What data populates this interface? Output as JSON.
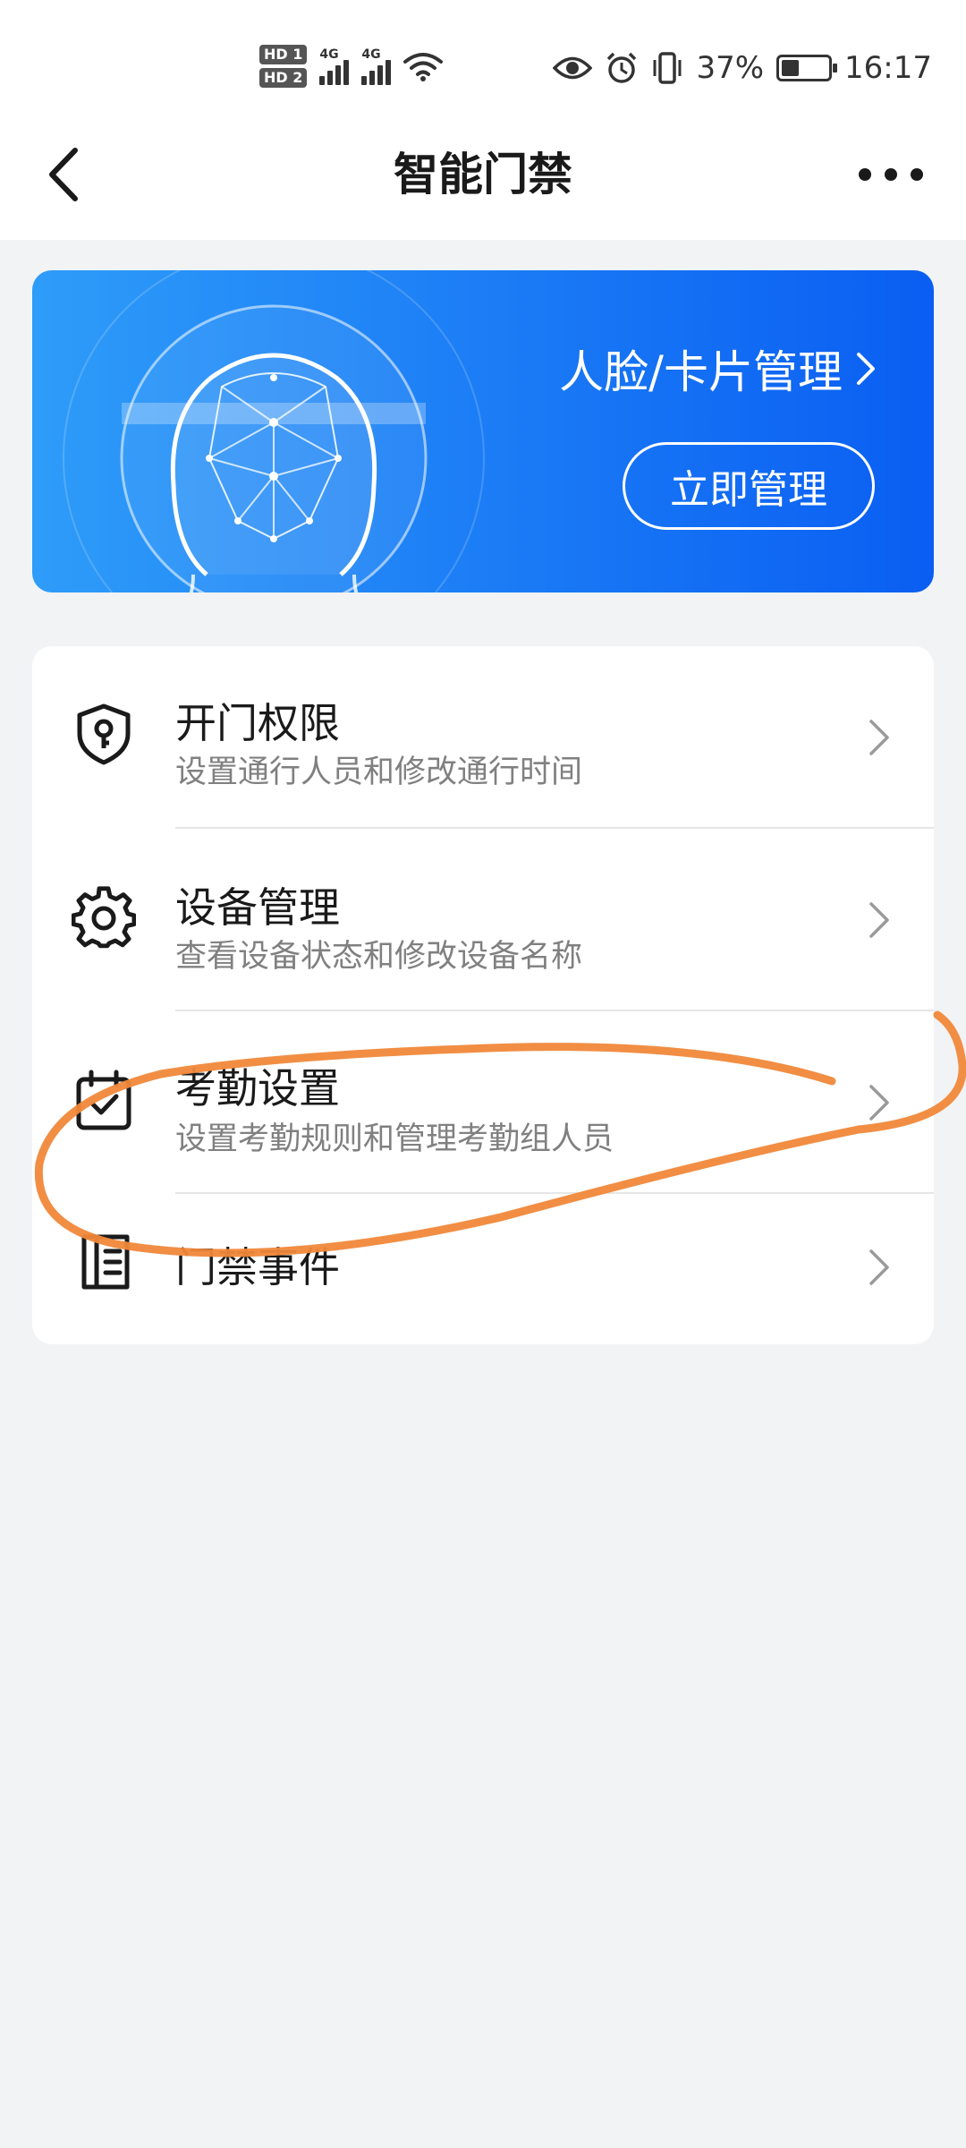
{
  "status_bar": {
    "sim1_label": "HD 1",
    "sim2_label": "HD 2",
    "net1_label": "4G",
    "net2_label": "4G",
    "battery_percent_text": "37%",
    "battery_level": 0.37,
    "time": "16:17",
    "icons": [
      "eye-icon",
      "alarm-icon",
      "vibrate-icon",
      "wifi-icon",
      "battery-charging-icon"
    ]
  },
  "header": {
    "title": "智能门禁",
    "back_icon": "chevron-left-icon",
    "more_icon": "more-dots-icon"
  },
  "banner": {
    "link_text": "人脸/卡片管理",
    "button_label": "立即管理",
    "colors": {
      "start": "#2e9cf9",
      "end": "#0a5ef2"
    }
  },
  "menu": {
    "items": [
      {
        "title": "开门权限",
        "desc": "设置通行人员和修改通行时间",
        "icon": "shield-key-icon"
      },
      {
        "title": "设备管理",
        "desc": "查看设备状态和修改设备名称",
        "icon": "gear-icon"
      },
      {
        "title": "考勤设置",
        "desc": "设置考勤规则和管理考勤组人员",
        "icon": "calendar-check-icon"
      },
      {
        "title": "门禁事件",
        "desc": "",
        "icon": "door-list-icon"
      }
    ]
  },
  "annotation": {
    "color": "#f0883a"
  }
}
